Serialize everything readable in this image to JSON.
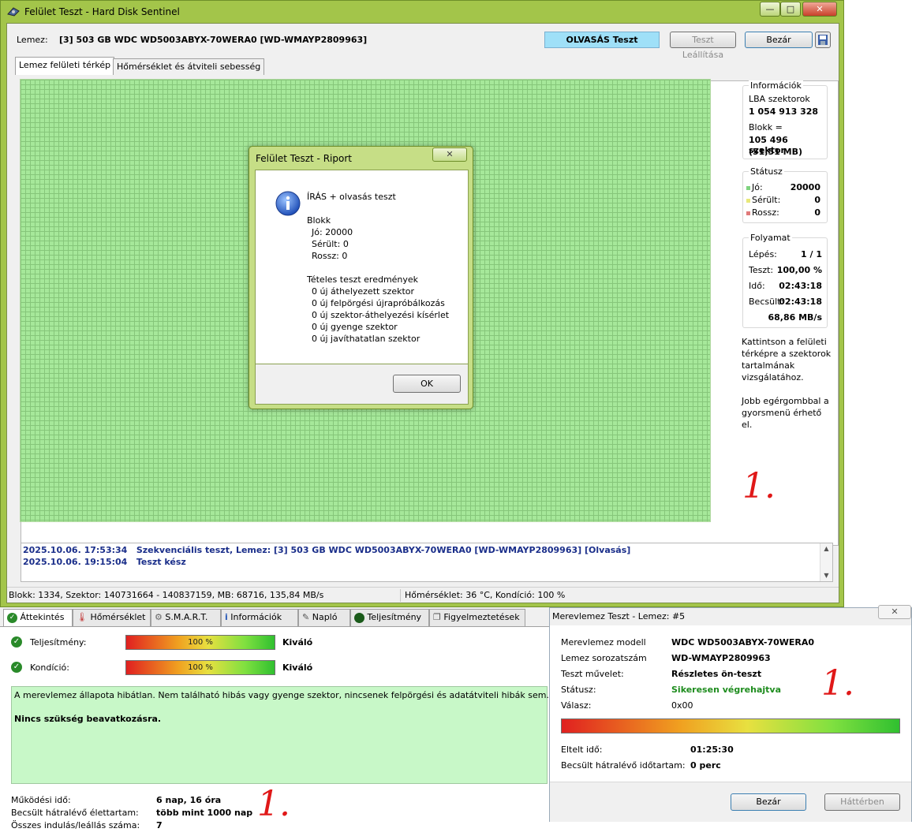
{
  "main_window": {
    "title": "Felület Teszt - Hard Disk Sentinel",
    "min_glyph": "—",
    "max_glyph": "□",
    "close_glyph": "✕"
  },
  "toolbar": {
    "disk_label": "Lemez:",
    "disk_value": "[3] 503 GB  WDC WD5003ABYX-70WERA0 [WD-WMAYP2809963]",
    "mode_label": "OLVASÁS Teszt",
    "stop_label": "Teszt Leállítása",
    "close_label": "Bezár"
  },
  "tabs": [
    "Lemez felületi térkép",
    "Hőmérséklet és átviteli sebesség"
  ],
  "info": {
    "title": "Információk",
    "lba_label": "LBA szektorok",
    "lba_value": "1 054 913 328",
    "block_label": "Blokk =",
    "block_value": "105 496 szektor",
    "block_mb": "(51,51 MB)"
  },
  "status": {
    "title": "Státusz",
    "good_label": "Jó:",
    "good_value": "20000",
    "damaged_label": "Sérült:",
    "damaged_value": "0",
    "bad_label": "Rossz:",
    "bad_value": "0",
    "good_color": "#7fd37f",
    "damaged_color": "#e8e87a",
    "bad_color": "#e07a7a"
  },
  "progress": {
    "title": "Folyamat",
    "step_label": "Lépés:",
    "step_value": "1 / 1",
    "test_label": "Teszt:",
    "test_value": "100,00 %",
    "time_label": "Idő:",
    "time_value": "02:43:18",
    "est_label": "Becsült:",
    "est_value": "02:43:18",
    "speed": "68,86 MB/s"
  },
  "hint": {
    "line1": "Kattintson a felületi",
    "line2": "térképre a szektorok",
    "line3": "tartalmának",
    "line4": "vizsgálatához.",
    "line5": "Jobb egérgombbal a",
    "line6": "gyorsmenü érhető",
    "line7": "el."
  },
  "handwriting": {
    "mark": "1."
  },
  "log": [
    {
      "time": "2025.10.06.  17:53:34",
      "text": "Szekvenciális teszt, Lemez: [3] 503 GB  WDC WD5003ABYX-70WERA0 [WD-WMAYP2809963] [Olvasás]"
    },
    {
      "time": "2025.10.06.  19:15:04",
      "text": "Teszt kész"
    }
  ],
  "statusbar": {
    "left": "Blokk: 1334, Szektor: 140731664 - 140837159, MB: 68716, 135,84 MB/s",
    "right": "Hőmérséklet: 36  °C,  Kondíció: 100 %"
  },
  "report_dialog": {
    "title": "Felület Teszt - Riport",
    "heading": "ÍRÁS + olvasás teszt",
    "block_title": "Blokk",
    "good": "Jó: 20000",
    "damaged": "Sérült: 0",
    "bad": "Rossz: 0",
    "results_title": "Tételes teszt eredmények",
    "r1": "0 új áthelyezett szektor",
    "r2": "0 új felpörgési újrapróbálkozás",
    "r3": "0 új szektor-áthelyezési kísérlet",
    "r4": "0 új gyenge szektor",
    "r5": "0 új javíthatatlan szektor",
    "ok_label": "OK"
  },
  "lower_tabs": [
    "Áttekintés",
    "Hőmérséklet",
    "S.M.A.R.T.",
    "Információk",
    "Napló",
    "Teljesítmény",
    "Figyelmeztetések"
  ],
  "overview": {
    "perf_label": "Teljesítmény:",
    "perf_value": "100 %",
    "perf_fraction": 1.0,
    "perf_rating": "Kiváló",
    "cond_label": "Kondíció:",
    "cond_value": "100 %",
    "cond_fraction": 1.0,
    "cond_rating": "Kiváló",
    "message": "A merevlemez állapota hibátlan. Nem található hibás vagy gyenge szektor, nincsenek felpörgési és adatátviteli hibák sem.",
    "action": "Nincs szükség beavatkozásra.",
    "uptime_label": "Működési idő:",
    "uptime_value": "6 nap, 16 óra",
    "life_label": "Becsült hátralévő élettartam:",
    "life_value": "több mint 1000 nap",
    "starts_label": "Összes indulás/leállás száma:",
    "starts_value": "7"
  },
  "disk_test_dialog": {
    "title": "Merevlemez Teszt - Lemez: #5",
    "model_label": "Merevlemez modell",
    "model_value": "WDC WD5003ABYX-70WERA0",
    "serial_label": "Lemez sorozatszám",
    "serial_value": "WD-WMAYP2809963",
    "op_label": "Teszt művelet:",
    "op_value": "Részletes ön-teszt",
    "status_label": "Státusz:",
    "status_value": "Sikeresen végrehajtva",
    "status_color": "#1e8c1e",
    "resp_label": "Válasz:",
    "resp_value": "0x00",
    "progress_fraction": 1.0,
    "elapsed_label": "Eltelt idő:",
    "elapsed_value": "01:25:30",
    "remaining_label": "Becsült hátralévő időtartam:",
    "remaining_value": "0 perc",
    "close_label": "Bezár",
    "bg_label": "Háttérben"
  }
}
